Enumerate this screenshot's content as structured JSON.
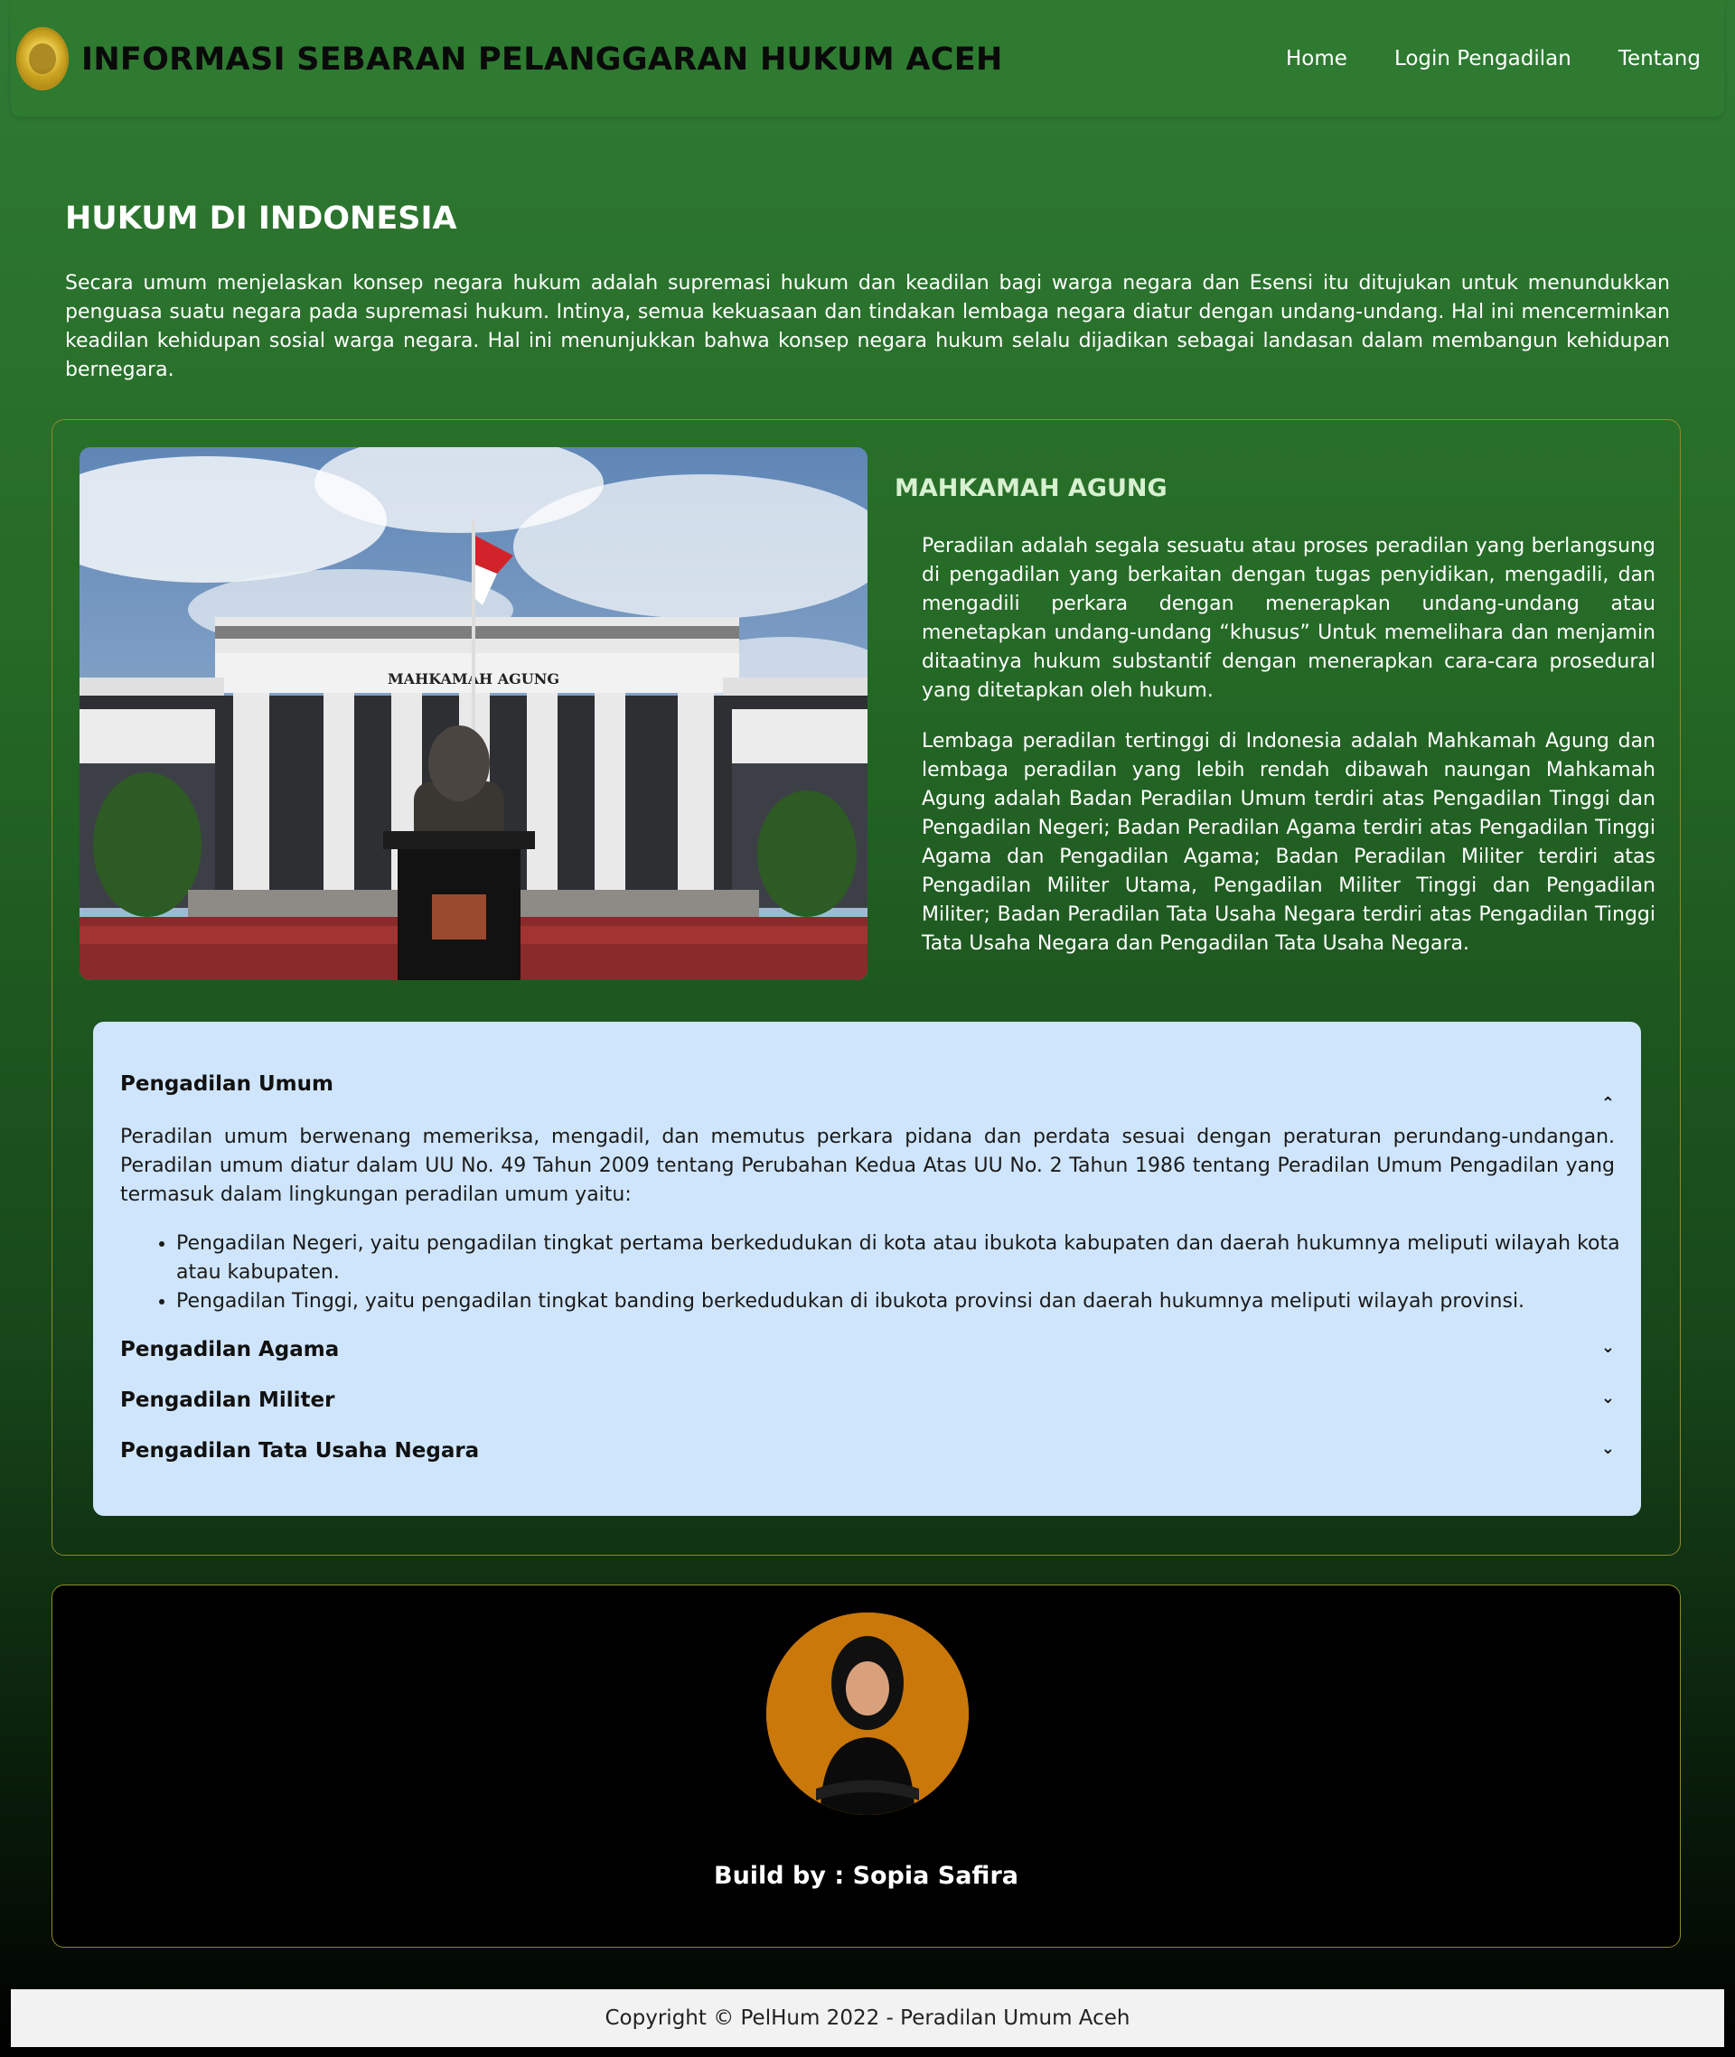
{
  "navbar": {
    "brand": "INFORMASI SEBARAN PELANGGARAN HUKUM ACEH",
    "links": [
      "Home",
      "Login Pengadilan",
      "Tentang"
    ]
  },
  "hero": {
    "title": "HUKUM DI INDONESIA",
    "text": "Secara umum menjelaskan konsep negara hukum adalah supremasi hukum dan keadilan bagi warga negara dan Esensi itu ditujukan untuk menundukkan penguasa suatu negara pada supremasi hukum. Intinya, semua kekuasaan dan tindakan lembaga negara diatur dengan undang-undang. Hal ini mencerminkan keadilan kehidupan sosial warga negara. Hal ini menunjukkan bahwa konsep negara hukum selalu dijadikan sebagai landasan dalam membangun kehidupan bernegara."
  },
  "mahkamah": {
    "building_sign": "MAHKAMAH AGUNG",
    "title": "MAHKAMAH AGUNG",
    "paragraph1": "Peradilan adalah segala sesuatu atau proses peradilan yang berlangsung di pengadilan yang berkaitan dengan tugas penyidikan, mengadili, dan mengadili perkara dengan menerapkan undang-undang atau menetapkan undang-undang “khusus” Untuk memelihara dan menjamin ditaatinya hukum substantif dengan menerapkan cara-cara prosedural yang ditetapkan oleh hukum.",
    "paragraph2": "Lembaga peradilan tertinggi di Indonesia adalah Mahkamah Agung dan lembaga peradilan yang lebih rendah dibawah naungan Mahkamah Agung adalah Badan Peradilan Umum terdiri atas Pengadilan Tinggi dan Pengadilan Negeri; Badan Peradilan Agama terdiri atas Pengadilan Tinggi Agama dan Pengadilan Agama; Badan Peradilan Militer terdiri atas Pengadilan Militer Utama, Pengadilan Militer Tinggi dan Pengadilan Militer; Badan Peradilan Tata Usaha Negara terdiri atas Pengadilan Tinggi Tata Usaha Negara dan Pengadilan Tata Usaha Negara."
  },
  "accordion": {
    "items": [
      {
        "title": "Pengadilan Umum",
        "expanded": true
      },
      {
        "title": "Pengadilan Agama",
        "expanded": false
      },
      {
        "title": "Pengadilan Militer",
        "expanded": false
      },
      {
        "title": "Pengadilan Tata Usaha Negara",
        "expanded": false
      }
    ],
    "umum_body": "Peradilan umum berwenang memeriksa, mengadil, dan memutus perkara pidana dan perdata sesuai dengan peraturan perundang-undangan. Peradilan umum diatur dalam UU No. 49 Tahun 2009 tentang Perubahan Kedua Atas UU No. 2 Tahun 1986 tentang Peradilan Umum Pengadilan yang termasuk dalam lingkungan peradilan umum yaitu:",
    "umum_list": [
      "Pengadilan Negeri, yaitu pengadilan tingkat pertama berkedudukan di kota atau ibukota kabupaten dan daerah hukumnya meliputi wilayah kota atau kabupaten.",
      "Pengadilan Tinggi, yaitu pengadilan tingkat banding berkedudukan di ibukota provinsi dan daerah hukumnya meliputi wilayah provinsi."
    ],
    "icons": {
      "expanded": "chevron-up-icon",
      "collapsed": "chevron-down-icon"
    }
  },
  "profile": {
    "builder": "Build by : Sopia Safira"
  },
  "footer": {
    "copyright": "Copyright © PelHum 2022 - Peradilan Umum Aceh"
  },
  "colors": {
    "navbar": "#2e7a31",
    "accordion_bg": "#cfe5fc",
    "avatar_bg": "#c97809",
    "card_border": "#8f8a2a"
  }
}
